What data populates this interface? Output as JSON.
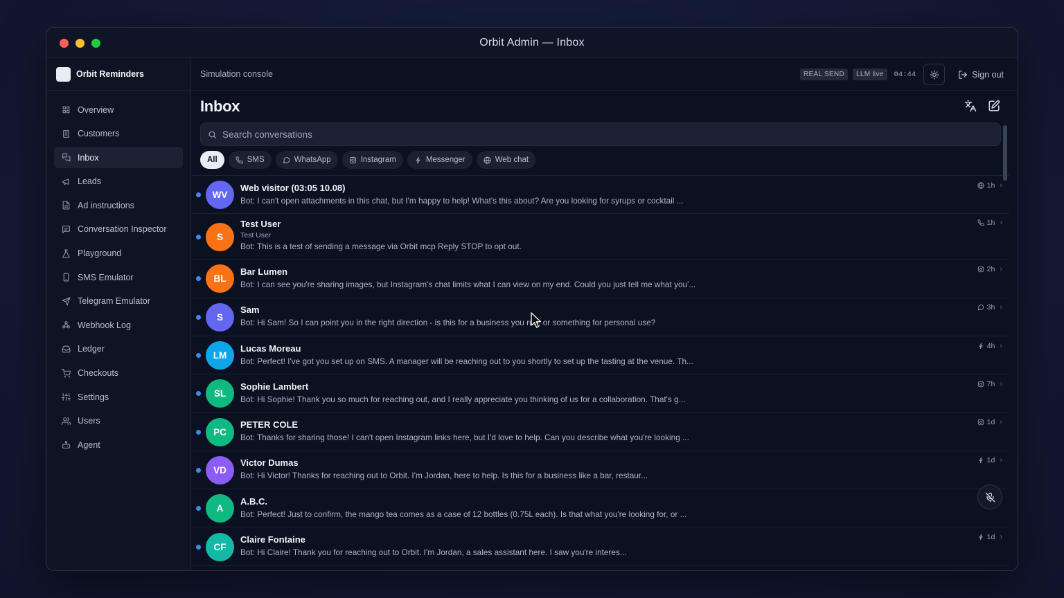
{
  "window": {
    "title": "Orbit Admin — Inbox"
  },
  "sidebar": {
    "brand": "Orbit Reminders",
    "items": [
      {
        "label": "Overview",
        "icon": "grid-icon",
        "active": false
      },
      {
        "label": "Customers",
        "icon": "building-icon",
        "active": false
      },
      {
        "label": "Inbox",
        "icon": "chat-icon",
        "active": true
      },
      {
        "label": "Leads",
        "icon": "megaphone-icon",
        "active": false
      },
      {
        "label": "Ad instructions",
        "icon": "document-icon",
        "active": false
      },
      {
        "label": "Conversation Inspector",
        "icon": "message-square-icon",
        "active": false
      },
      {
        "label": "Playground",
        "icon": "flask-icon",
        "active": false
      },
      {
        "label": "SMS Emulator",
        "icon": "phone-device-icon",
        "active": false
      },
      {
        "label": "Telegram Emulator",
        "icon": "send-icon",
        "active": false
      },
      {
        "label": "Webhook Log",
        "icon": "webhook-icon",
        "active": false
      },
      {
        "label": "Ledger",
        "icon": "inbox-tray-icon",
        "active": false
      },
      {
        "label": "Checkouts",
        "icon": "cart-icon",
        "active": false
      },
      {
        "label": "Settings",
        "icon": "sliders-icon",
        "active": false
      },
      {
        "label": "Users",
        "icon": "users-icon",
        "active": false
      },
      {
        "label": "Agent",
        "icon": "bot-icon",
        "active": false
      }
    ]
  },
  "topbar": {
    "console_label": "Simulation console",
    "badge_real_send": "REAL SEND",
    "badge_llm": "LLM live",
    "timer": "04:44",
    "sign_out": "Sign out"
  },
  "inbox": {
    "title": "Inbox",
    "search_placeholder": "Search conversations",
    "filters": [
      {
        "label": "All",
        "icon": "",
        "active": true
      },
      {
        "label": "SMS",
        "icon": "phone-icon",
        "active": false
      },
      {
        "label": "WhatsApp",
        "icon": "whatsapp-icon",
        "active": false
      },
      {
        "label": "Instagram",
        "icon": "instagram-icon",
        "active": false
      },
      {
        "label": "Messenger",
        "icon": "messenger-icon",
        "active": false
      },
      {
        "label": "Web chat",
        "icon": "globe-icon",
        "active": false
      }
    ],
    "conversations": [
      {
        "initials": "WV",
        "color": "#6366f1",
        "name": "Web visitor (03:05 10.08)",
        "sub": "",
        "preview": "Bot: I can't open attachments in this chat, but I'm happy to help! What's this about? Are you looking for syrups or cocktail ...",
        "channel": "globe-icon",
        "time": "1h"
      },
      {
        "initials": "S",
        "color": "#f97316",
        "name": "Test User",
        "sub": "Test User",
        "preview": "Bot: This is a test of sending a message via Orbit mcp Reply STOP to opt out.",
        "channel": "phone-icon",
        "time": "1h"
      },
      {
        "initials": "BL",
        "color": "#f97316",
        "name": "Bar Lumen",
        "sub": "",
        "preview": "Bot: I can see you're sharing images, but Instagram's chat limits what I can view on my end. Could you just tell me what you'...",
        "channel": "instagram-icon",
        "time": "2h"
      },
      {
        "initials": "S",
        "color": "#6366f1",
        "name": "Sam",
        "sub": "",
        "preview": "Bot: Hi Sam! So I can point you in the right direction - is this for a business you run, or something for personal use?",
        "channel": "whatsapp-icon",
        "time": "3h"
      },
      {
        "initials": "LM",
        "color": "#0ea5e9",
        "name": "Lucas Moreau",
        "sub": "",
        "preview": "Bot: Perfect! I've got you set up on SMS. A manager will be reaching out to you shortly to set up the tasting at the venue. Th...",
        "channel": "messenger-icon",
        "time": "4h"
      },
      {
        "initials": "SL",
        "color": "#10b981",
        "name": "Sophie Lambert",
        "sub": "",
        "preview": "Bot: Hi Sophie! Thank you so much for reaching out, and I really appreciate you thinking of us for a collaboration. That's g...",
        "channel": "instagram-icon",
        "time": "7h"
      },
      {
        "initials": "PC",
        "color": "#10b981",
        "name": "PETER COLE",
        "sub": "",
        "preview": "Bot: Thanks for sharing those! I can't open Instagram links here, but I'd love to help. Can you describe what you're looking ...",
        "channel": "instagram-icon",
        "time": "1d"
      },
      {
        "initials": "VD",
        "color": "#8b5cf6",
        "name": "Victor Dumas",
        "sub": "",
        "preview": "Bot: Hi Victor! Thanks for reaching out to Orbit. I'm Jordan, here to help. Is this for a business like a bar, restaur...",
        "channel": "messenger-icon",
        "time": "1d"
      },
      {
        "initials": "A",
        "color": "#10b981",
        "name": "A.B.C.",
        "sub": "",
        "preview": "Bot: Perfect! Just to confirm, the mango tea comes as a case of 12 bottles (0.75L each). Is that what you're looking for, or ...",
        "channel": "instagram-icon",
        "time": ""
      },
      {
        "initials": "CF",
        "color": "#14b8a6",
        "name": "Claire Fontaine",
        "sub": "",
        "preview": "Bot: Hi Claire! Thank you for reaching out to Orbit. I'm Jordan, a sales assistant here. I saw you're interes...",
        "channel": "messenger-icon",
        "time": "1d"
      }
    ]
  }
}
